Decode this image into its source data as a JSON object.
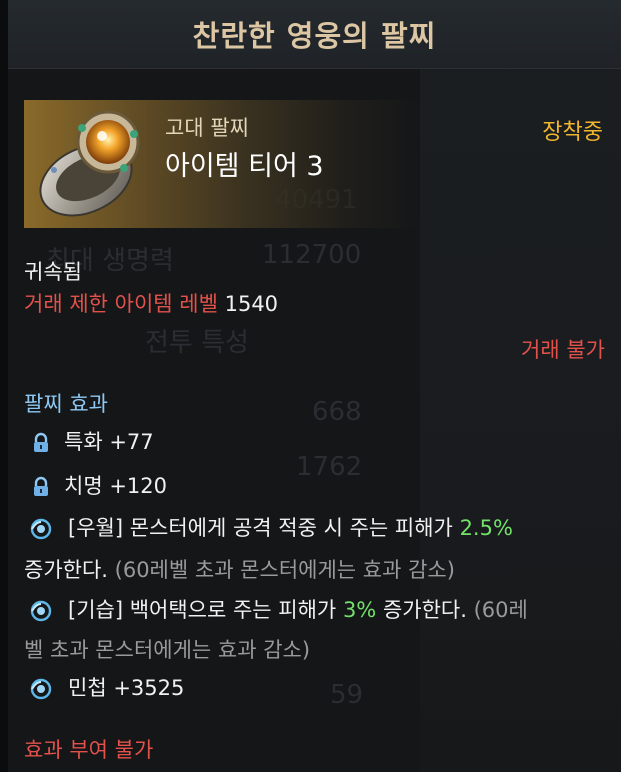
{
  "title": "찬란한 영웅의 팔찌",
  "item": {
    "grade_label": "고대 팔찌",
    "tier_label": "아이템 티어 3",
    "equipped_label": "장착중"
  },
  "bound_label": "귀속됨",
  "trade_limit": {
    "label": "거래 제한 아이템 레벨",
    "value": "1540"
  },
  "trade_status": "거래 불가",
  "effects": {
    "header": "팔찌 효과",
    "lines": [
      {
        "icon": "lock-icon",
        "text": "특화 +77"
      },
      {
        "icon": "lock-icon",
        "text": "치명 +120"
      }
    ],
    "special1": {
      "prefix": "[우월] 몬스터에게 공격 적중 시 주는 피해가 ",
      "highlight": "2.5%",
      "line2_main": "증가한다. ",
      "line2_note": "(60레벨 초과 몬스터에게는 효과 감소)"
    },
    "special2": {
      "prefix": "[기습] 백어택으로 주는 피해가 ",
      "highlight": "3%",
      "mid": " 증가한다. ",
      "note_part1": "(60레",
      "note_part2": "벨 초과 몬스터에게는 효과 감소)"
    },
    "agility": "민첩 +3525"
  },
  "cannot_grant": "효과 부여 불가",
  "colors": {
    "title": "#dcc6a4",
    "red": "#e2524a",
    "orange": "#f2b62e",
    "blue_header": "#8ec8f2",
    "green": "#74e06a"
  }
}
